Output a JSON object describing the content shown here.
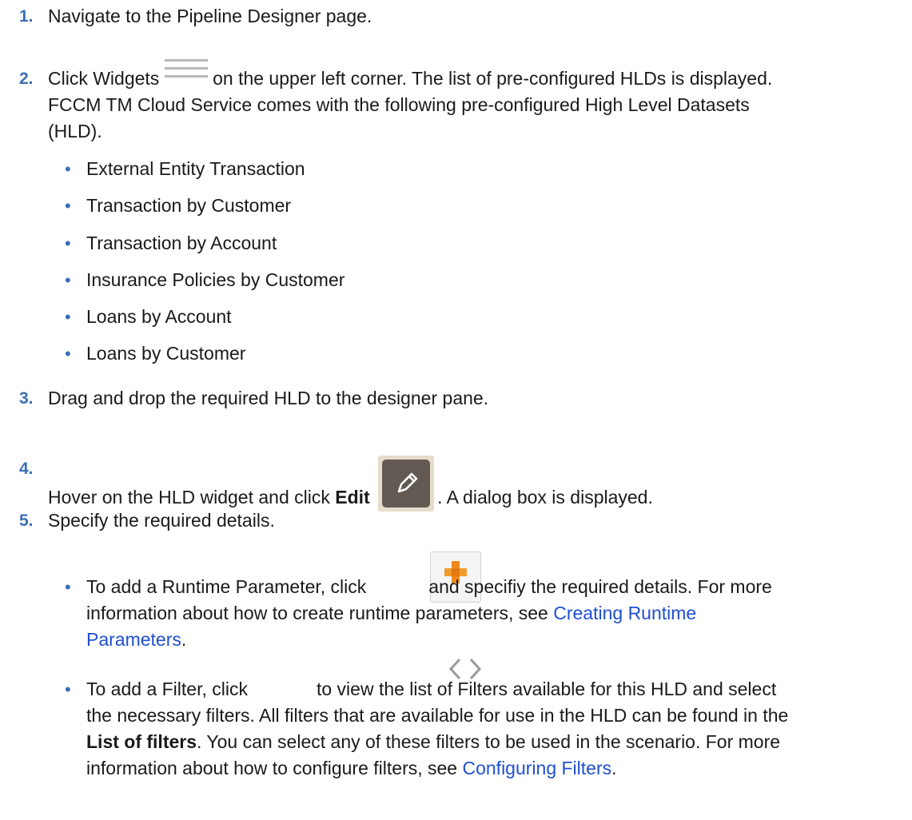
{
  "steps": [
    {
      "num": "1.",
      "text": "Navigate to the Pipeline Designer page."
    },
    {
      "num": "2.",
      "pre": "Click Widgets",
      "post": " on the upper left corner. The list of pre-configured HLDs is displayed.",
      "line2": "FCCM TM Cloud Service comes with the following pre-configured High Level Datasets",
      "line3": "(HLD)."
    },
    {
      "num": "3.",
      "text": "Drag and drop the required HLD to the designer pane."
    },
    {
      "num": "4.",
      "pre": "Hover on the HLD widget and click ",
      "bold": "Edit",
      "post": ". A dialog box is displayed."
    },
    {
      "num": "5.",
      "text": "Specify the required details."
    }
  ],
  "hld_list": [
    "External Entity Transaction",
    "Transaction by Customer",
    "Transaction by Account",
    "Insurance Policies by Customer",
    "Loans by Account",
    "Loans by Customer"
  ],
  "runtime": {
    "pre": "To add a Runtime Parameter, click",
    "post": "and specifiy the required details. For more",
    "line2": "information about how to create runtime parameters, see ",
    "link_a": "Creating Runtime",
    "link_b": "Parameters",
    "end": "."
  },
  "filter": {
    "pre": "To add a Filter, click",
    "post": "to view the list of Filters available for this HLD and select",
    "line2": "the necessary filters. All filters that are available for use in the HLD can be found in the",
    "bold": "List of filters",
    "line3": ". You can select any of these filters to be used in the scenario. For more",
    "line4": "information about how to configure filters, see ",
    "link": "Configuring Filters",
    "end": "."
  },
  "icons": {
    "widgets": "hamburger-menu-icon",
    "edit": "pencil-icon",
    "add": "plus-icon",
    "filter": "code-brackets-icon"
  },
  "colors": {
    "step_number": "#3a6fb5",
    "link": "#1f4fd1",
    "plus": "#f08a1c"
  }
}
